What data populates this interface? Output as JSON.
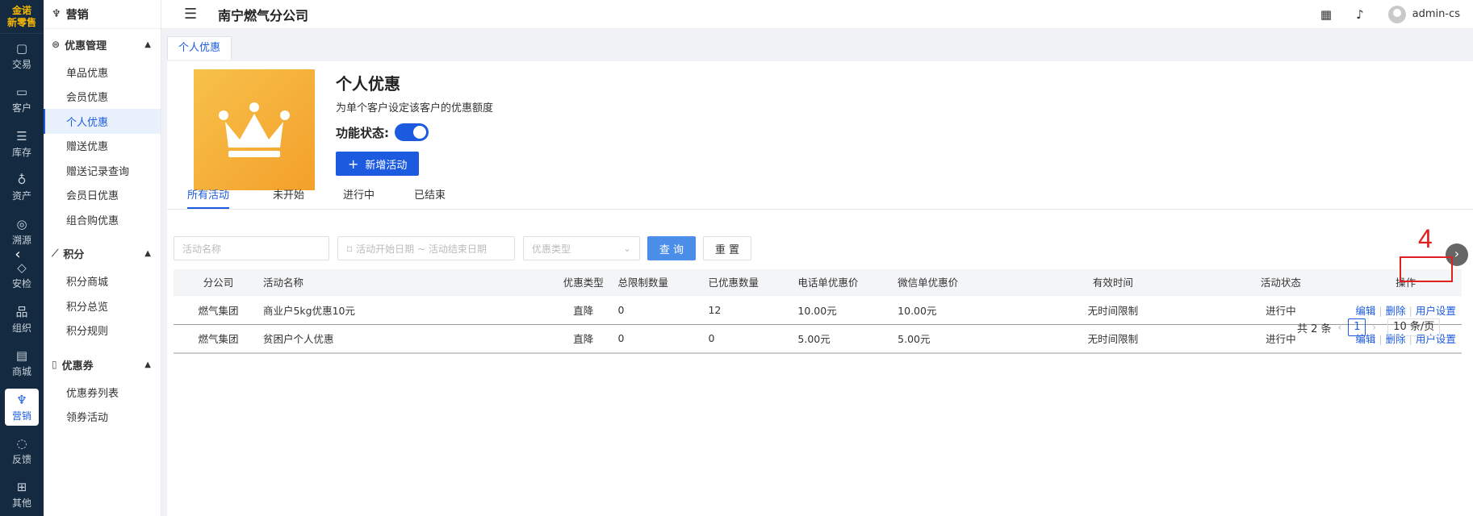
{
  "rail": {
    "logo_top": "金诺",
    "logo_sub": "新零售",
    "items": [
      {
        "label": "交易",
        "icon": "bag-icon"
      },
      {
        "label": "客户",
        "icon": "id-card-icon"
      },
      {
        "label": "库存",
        "icon": "inventory-icon"
      },
      {
        "label": "资产",
        "icon": "bulb-icon"
      },
      {
        "label": "溯源",
        "icon": "compass-icon"
      },
      {
        "label": "安检",
        "icon": "shield-icon"
      },
      {
        "label": "组织",
        "icon": "org-icon"
      },
      {
        "label": "商城",
        "icon": "store-icon"
      },
      {
        "label": "营销",
        "icon": "trophy-icon"
      },
      {
        "label": "反馈",
        "icon": "chat-icon"
      },
      {
        "label": "其他",
        "icon": "apps-icon"
      }
    ]
  },
  "subnav": {
    "title": "营销",
    "groups": [
      {
        "label": "优惠管理",
        "items": [
          "单品优惠",
          "会员优惠",
          "个人优惠",
          "赠送优惠",
          "赠送记录查询",
          "会员日优惠",
          "组合购优惠"
        ]
      },
      {
        "label": "积分",
        "items": [
          "积分商城",
          "积分总览",
          "积分规则"
        ]
      },
      {
        "label": "优惠券",
        "items": [
          "优惠券列表",
          "领券活动"
        ]
      }
    ]
  },
  "header": {
    "company": "南宁燃气分公司",
    "username": "admin-cs"
  },
  "page_tab": "个人优惠",
  "hero": {
    "title": "个人优惠",
    "description": "为单个客户设定该客户的优惠额度",
    "status_label": "功能状态:",
    "add_button": "新增活动"
  },
  "tabs": [
    "所有活动",
    "未开始",
    "进行中",
    "已结束"
  ],
  "filters": {
    "name_placeholder": "活动名称",
    "date_placeholder": "活动开始日期 ~ 活动结束日期",
    "type_placeholder": "优惠类型",
    "search_button": "查 询",
    "reset_button": "重 置"
  },
  "table": {
    "columns": [
      "分公司",
      "活动名称",
      "优惠类型",
      "总限制数量",
      "已优惠数量",
      "电话单优惠价",
      "微信单优惠价",
      "有效时间",
      "活动状态",
      "操作"
    ],
    "rows": [
      {
        "company": "燃气集团",
        "name": "商业户5kg优惠10元",
        "type": "直降",
        "limit": "0",
        "used": "12",
        "phone_price": "10.00元",
        "wechat_price": "10.00元",
        "valid": "无时间限制",
        "status": "进行中"
      },
      {
        "company": "燃气集团",
        "name": "贫困户个人优惠",
        "type": "直降",
        "limit": "0",
        "used": "0",
        "phone_price": "5.00元",
        "wechat_price": "5.00元",
        "valid": "无时间限制",
        "status": "进行中"
      }
    ],
    "actions": {
      "edit": "编辑",
      "delete": "删除",
      "user_settings": "用户设置"
    }
  },
  "annotation": {
    "step": "4"
  },
  "pagination": {
    "total": "共 2 条",
    "current": "1",
    "page_size": "10 条/页"
  }
}
